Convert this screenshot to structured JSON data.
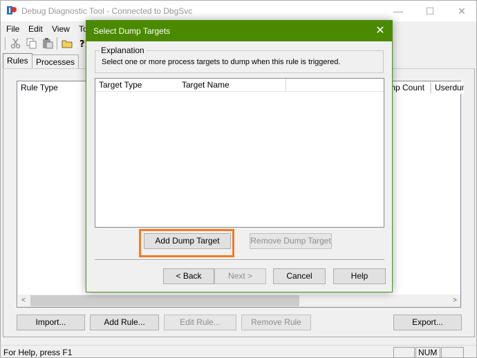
{
  "app": {
    "title": "Debug Diagnostic Tool - Connected to DbgSvc",
    "menu": [
      "File",
      "Edit",
      "View",
      "To"
    ],
    "tabs": [
      "Rules",
      "Processes"
    ],
    "columns": [
      "Rule Type",
      "mp Count",
      "Userdum"
    ],
    "buttons": {
      "import": "Import...",
      "add_rule": "Add Rule...",
      "edit_rule": "Edit Rule...",
      "remove_rule": "Remove Rule",
      "export": "Export..."
    },
    "status": {
      "help": "For Help, press F1",
      "num": "NUM"
    },
    "window_controls": {
      "minimize": "—",
      "maximize": "☐",
      "close": "✕"
    }
  },
  "dialog": {
    "title": "Select Dump Targets",
    "close": "✕",
    "explanation_label": "Explanation",
    "explanation_text": "Select one or more process targets to dump when this rule is triggered.",
    "columns": [
      "Target Type",
      "Target Name"
    ],
    "buttons": {
      "add": "Add Dump Target",
      "remove": "Remove Dump Target",
      "back": "< Back",
      "next": "Next >",
      "cancel": "Cancel",
      "help": "Help"
    }
  },
  "colors": {
    "dialog_title_bg": "#4b8a00",
    "highlight": "#f47c20"
  }
}
